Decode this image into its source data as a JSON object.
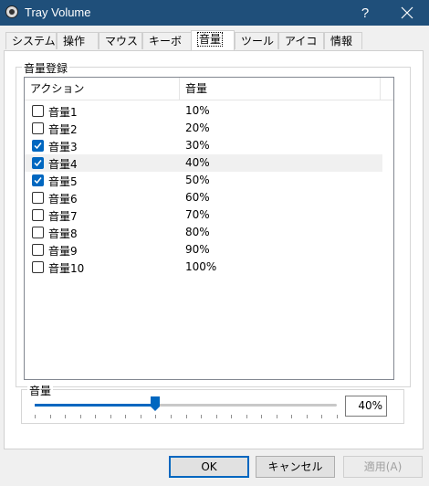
{
  "window": {
    "title": "Tray Volume",
    "help_glyph": "?",
    "icon": "speaker-app-icon",
    "colors": {
      "titlebar": "#1f4f7a",
      "accent": "#0067c0"
    }
  },
  "tabs": [
    {
      "label": "システム"
    },
    {
      "label": "操作"
    },
    {
      "label": "マウス"
    },
    {
      "label": "キーボード"
    },
    {
      "label": "音量",
      "active": true
    },
    {
      "label": "ツール"
    },
    {
      "label": "アイコン"
    },
    {
      "label": "情報"
    }
  ],
  "volume_registration": {
    "label": "音量登録",
    "columns": [
      "アクション",
      "音量"
    ],
    "rows": [
      {
        "name": "音量1",
        "value": "10%",
        "checked": false
      },
      {
        "name": "音量2",
        "value": "20%",
        "checked": false
      },
      {
        "name": "音量3",
        "value": "30%",
        "checked": true
      },
      {
        "name": "音量4",
        "value": "40%",
        "checked": true,
        "highlighted": true
      },
      {
        "name": "音量5",
        "value": "50%",
        "checked": true
      },
      {
        "name": "音量6",
        "value": "60%",
        "checked": false
      },
      {
        "name": "音量7",
        "value": "70%",
        "checked": false
      },
      {
        "name": "音量8",
        "value": "80%",
        "checked": false
      },
      {
        "name": "音量9",
        "value": "90%",
        "checked": false
      },
      {
        "name": "音量10",
        "value": "100%",
        "checked": false
      }
    ]
  },
  "volume_slider": {
    "label": "音量",
    "value_text": "40%",
    "fraction": 0.4,
    "tick_count": 21
  },
  "buttons": {
    "ok": "OK",
    "cancel": "キャンセル",
    "apply": "適用(A)"
  }
}
